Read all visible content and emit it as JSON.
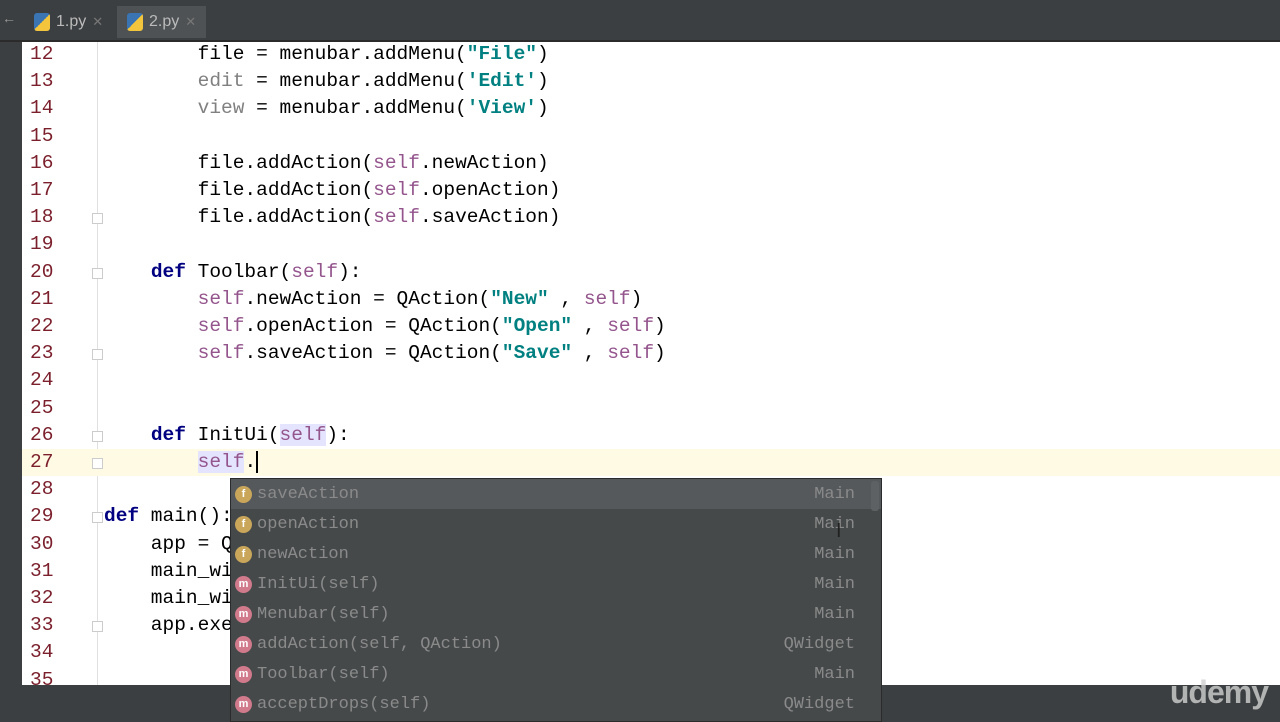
{
  "tabs": [
    {
      "label": "1.py",
      "active": false
    },
    {
      "label": "2.py",
      "active": true
    }
  ],
  "editor": {
    "current_line": 27,
    "lines": [
      {
        "n": "12",
        "fold": false,
        "tokens": [
          [
            "        file = menubar.addMenu(",
            ""
          ],
          [
            "\"File\"",
            "str"
          ],
          [
            ")",
            ""
          ]
        ]
      },
      {
        "n": "13",
        "fold": false,
        "tokens": [
          [
            "        ",
            ""
          ],
          [
            "edit",
            "unused"
          ],
          [
            " = menubar.addMenu(",
            ""
          ],
          [
            "'Edit'",
            "str"
          ],
          [
            ")",
            ""
          ]
        ]
      },
      {
        "n": "14",
        "fold": false,
        "tokens": [
          [
            "        ",
            ""
          ],
          [
            "view",
            "unused"
          ],
          [
            " = menubar.addMenu(",
            ""
          ],
          [
            "'View'",
            "str"
          ],
          [
            ")",
            ""
          ]
        ]
      },
      {
        "n": "15",
        "fold": false,
        "tokens": []
      },
      {
        "n": "16",
        "fold": false,
        "tokens": [
          [
            "        file.addAction(",
            ""
          ],
          [
            "self",
            "self"
          ],
          [
            ".newAction)",
            ""
          ]
        ]
      },
      {
        "n": "17",
        "fold": false,
        "tokens": [
          [
            "        file.addAction(",
            ""
          ],
          [
            "self",
            "self"
          ],
          [
            ".openAction)",
            ""
          ]
        ]
      },
      {
        "n": "18",
        "fold": true,
        "tokens": [
          [
            "        file.addAction(",
            ""
          ],
          [
            "self",
            "self"
          ],
          [
            ".saveAction)",
            ""
          ]
        ]
      },
      {
        "n": "19",
        "fold": false,
        "tokens": []
      },
      {
        "n": "20",
        "fold": true,
        "tokens": [
          [
            "    ",
            ""
          ],
          [
            "def",
            "kw"
          ],
          [
            " Toolbar(",
            ""
          ],
          [
            "self",
            "self"
          ],
          [
            "):",
            ""
          ]
        ]
      },
      {
        "n": "21",
        "fold": false,
        "tokens": [
          [
            "        ",
            ""
          ],
          [
            "self",
            "self"
          ],
          [
            ".newAction = QAction(",
            ""
          ],
          [
            "\"New\"",
            "str"
          ],
          [
            " , ",
            ""
          ],
          [
            "self",
            "self"
          ],
          [
            ")",
            ""
          ]
        ]
      },
      {
        "n": "22",
        "fold": false,
        "tokens": [
          [
            "        ",
            ""
          ],
          [
            "self",
            "self"
          ],
          [
            ".openAction = QAction(",
            ""
          ],
          [
            "\"Open\"",
            "str"
          ],
          [
            " , ",
            ""
          ],
          [
            "self",
            "self"
          ],
          [
            ")",
            ""
          ]
        ]
      },
      {
        "n": "23",
        "fold": true,
        "tokens": [
          [
            "        ",
            ""
          ],
          [
            "self",
            "self"
          ],
          [
            ".saveAction = QAction(",
            ""
          ],
          [
            "\"Save\"",
            "str"
          ],
          [
            " , ",
            ""
          ],
          [
            "self",
            "self"
          ],
          [
            ")",
            ""
          ]
        ]
      },
      {
        "n": "24",
        "fold": false,
        "tokens": []
      },
      {
        "n": "25",
        "fold": false,
        "tokens": []
      },
      {
        "n": "26",
        "fold": true,
        "tokens": [
          [
            "    ",
            ""
          ],
          [
            "def",
            "kw"
          ],
          [
            " InitUi(",
            ""
          ],
          [
            "self",
            "self hl"
          ],
          [
            "):",
            ""
          ]
        ]
      },
      {
        "n": "27",
        "fold": true,
        "tokens": [
          [
            "        ",
            ""
          ],
          [
            "self",
            "self hl"
          ],
          [
            ".",
            ""
          ]
        ]
      },
      {
        "n": "28",
        "fold": false,
        "tokens": []
      },
      {
        "n": "29",
        "fold": true,
        "tokens": [
          [
            "def",
            "kw"
          ],
          [
            " main():",
            ""
          ]
        ]
      },
      {
        "n": "30",
        "fold": false,
        "tokens": [
          [
            "    app = Q",
            ""
          ]
        ]
      },
      {
        "n": "31",
        "fold": false,
        "tokens": [
          [
            "    main_wi",
            ""
          ]
        ]
      },
      {
        "n": "32",
        "fold": false,
        "tokens": [
          [
            "    main_wi",
            ""
          ]
        ]
      },
      {
        "n": "33",
        "fold": true,
        "tokens": [
          [
            "    app.exe",
            ""
          ]
        ]
      },
      {
        "n": "34",
        "fold": false,
        "tokens": []
      },
      {
        "n": "35",
        "fold": false,
        "tokens": []
      }
    ]
  },
  "completion": {
    "items": [
      {
        "kind": "f",
        "name": "saveAction",
        "owner": "Main",
        "selected": true
      },
      {
        "kind": "f",
        "name": "openAction",
        "owner": "Main"
      },
      {
        "kind": "f",
        "name": "newAction",
        "owner": "Main"
      },
      {
        "kind": "m",
        "name": "InitUi(self)",
        "owner": "Main"
      },
      {
        "kind": "m",
        "name": "Menubar(self)",
        "owner": "Main"
      },
      {
        "kind": "m",
        "name": "addAction(self, QAction)",
        "owner": "QWidget"
      },
      {
        "kind": "m",
        "name": "Toolbar(self)",
        "owner": "Main"
      },
      {
        "kind": "m",
        "name": "acceptDrops(self)",
        "owner": "QWidget"
      }
    ]
  },
  "watermark": "udemy"
}
